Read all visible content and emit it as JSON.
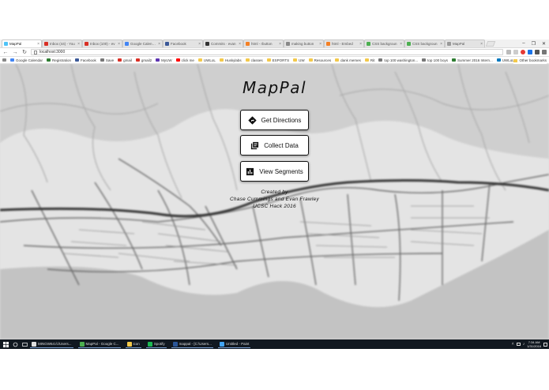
{
  "browser": {
    "tabs": [
      {
        "label": "MapPal",
        "color": "#4fc3f7",
        "active": true
      },
      {
        "label": "Inbox (44) - You",
        "color": "#d93025"
      },
      {
        "label": "Inbox (100) - ev",
        "color": "#d93025"
      },
      {
        "label": "Google Calendar",
        "color": "#4285f4"
      },
      {
        "label": "Facebook",
        "color": "#3b5998"
      },
      {
        "label": "Commits · evan",
        "color": "#333333"
      },
      {
        "label": "html - rbutton",
        "color": "#f48024"
      },
      {
        "label": "making button",
        "color": "#888888"
      },
      {
        "label": "html - Embed",
        "color": "#f48024"
      },
      {
        "label": "CSS backgroun",
        "color": "#4caf50"
      },
      {
        "label": "CSS backgroun",
        "color": "#4caf50"
      },
      {
        "label": "MapPal",
        "color": "#999999"
      }
    ],
    "url": "localhost:3000",
    "window_controls": [
      "–",
      "❐",
      "✕"
    ],
    "bookmarks": [
      {
        "label": "Google Calendar",
        "color": "#4285f4"
      },
      {
        "label": "Registration",
        "color": "#2e7d32"
      },
      {
        "label": "Facebook",
        "color": "#3b5998"
      },
      {
        "label": "Save",
        "color": "#777777"
      },
      {
        "label": "gmail",
        "color": "#d93025"
      },
      {
        "label": "gmail2",
        "color": "#d93025"
      },
      {
        "label": "MyUW",
        "color": "#5e35b1"
      },
      {
        "label": "click me",
        "color": "#ff0000"
      },
      {
        "label": "UWLoL",
        "color": "#f3c94b"
      },
      {
        "label": "Huskylabs",
        "color": "#f3c94b"
      },
      {
        "label": "classes",
        "color": "#f3c94b"
      },
      {
        "label": "ESPORTS",
        "color": "#f3c94b"
      },
      {
        "label": "UW",
        "color": "#f3c94b"
      },
      {
        "label": "Resources",
        "color": "#f3c94b"
      },
      {
        "label": "dank memes",
        "color": "#f3c94b"
      },
      {
        "label": "Rit",
        "color": "#f3c94b"
      },
      {
        "label": "top 100 washington...",
        "color": "#777777"
      },
      {
        "label": "top 100 boys",
        "color": "#777777"
      },
      {
        "label": "Summer 2016 Intern...",
        "color": "#2e7d32"
      },
      {
        "label": "UWLoL Trello",
        "color": "#0079bf"
      }
    ],
    "other_bookmarks": "Other bookmarks"
  },
  "app": {
    "title": "MapPal",
    "buttons": {
      "directions": "Get Directions",
      "collect": "Collect Data",
      "segments": "View Segments"
    },
    "credits": {
      "line1": "Created by",
      "line2": "Chase Cummings and Evan Frawley",
      "line3": "UCSC Hack 2016"
    }
  },
  "taskbar": {
    "tasks": [
      {
        "label": "MINGW64:/c/Users...",
        "color": "#e0e0e0"
      },
      {
        "label": "MapPal - Google C...",
        "color": "#4caf50"
      },
      {
        "label": "icon",
        "color": "#f3c94b"
      },
      {
        "label": "Spotify",
        "color": "#1db954"
      },
      {
        "label": "mappal - [C:\\Users...",
        "color": "#2b579a"
      },
      {
        "label": "Untitled - Paint",
        "color": "#42a5f5"
      }
    ],
    "time": "7:34 AM",
    "date": "1/31/2016"
  }
}
